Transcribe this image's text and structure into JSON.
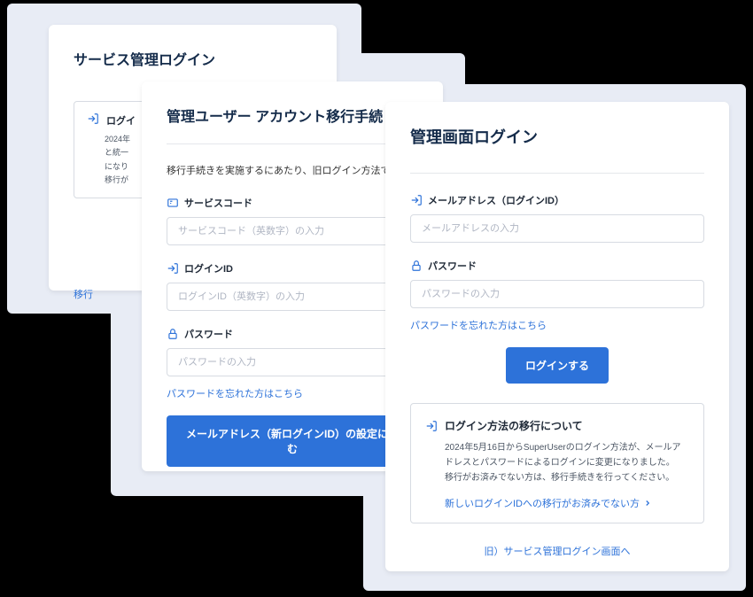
{
  "card1": {
    "title": "サービス管理ログイン",
    "notice_title": "ログイ",
    "notice_line1": "2024年",
    "notice_line2": "と統一",
    "notice_line3": "になり",
    "notice_line4": "移行が",
    "bottom_link": "移行"
  },
  "card2": {
    "title": "管理ユーザー アカウント移行手続",
    "subtitle": "移行手続きを実施するにあたり、旧ログイン方法で",
    "service_code_label": "サービスコード",
    "service_code_placeholder": "サービスコード（英数字）の入力",
    "login_id_label": "ログインID",
    "login_id_placeholder": "ログインID（英数字）の入力",
    "password_label": "パスワード",
    "password_placeholder": "パスワードの入力",
    "forgot_link": "パスワードを忘れた方はこちら",
    "submit_button": "メールアドレス（新ログインID）の設定に進む"
  },
  "card3": {
    "title": "管理画面ログイン",
    "email_label": "メールアドレス（ログインID）",
    "email_placeholder": "メールアドレスの入力",
    "password_label": "パスワード",
    "password_placeholder": "パスワードの入力",
    "forgot_link": "パスワードを忘れた方はこちら",
    "login_button": "ログインする",
    "notice_title": "ログイン方法の移行について",
    "notice_body": "2024年5月16日からSuperUserのログイン方法が、メールアドレスとパスワードによるログインに変更になりました。\n移行がお済みでない方は、移行手続きを行ってください。",
    "notice_link": "新しいログインIDへの移行がお済みでない方",
    "footer_link": "旧）サービス管理ログイン画面へ"
  }
}
